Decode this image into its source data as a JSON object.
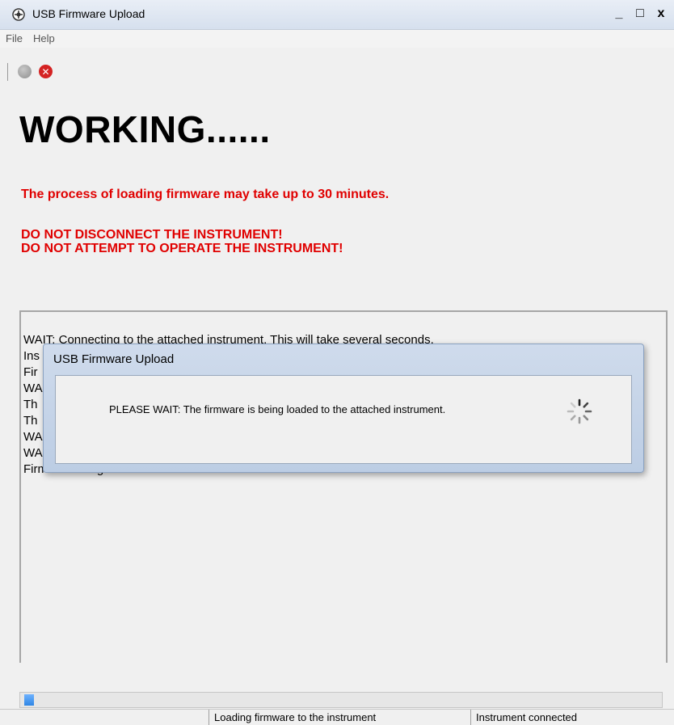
{
  "window": {
    "title": "USB Firmware Upload",
    "minimize": "_",
    "maximize": "□",
    "close": "x"
  },
  "menu": {
    "items": [
      "File",
      "Help"
    ]
  },
  "toolbar": {
    "stop_glyph": "✕"
  },
  "main": {
    "heading": "WORKING......",
    "warning_time": "The process of loading firmware may take up to 30 minutes.",
    "warning_disconnect": "DO NOT DISCONNECT THE INSTRUMENT!",
    "warning_operate": "DO NOT ATTEMPT TO OPERATE THE INSTRUMENT!"
  },
  "log": {
    "lines": [
      "WAIT: Connecting to the attached instrument. This will take several seconds.",
      "Ins",
      "Fir",
      "WA",
      "Th",
      "Th",
      "WA",
      "WA",
      "Firmware image erase successful"
    ]
  },
  "dialog": {
    "title": "USB Firmware Upload",
    "message": "PLEASE WAIT: The firmware is being loaded to the attached instrument."
  },
  "progress": {
    "value": 0.015
  },
  "status": {
    "cells": [
      "",
      "Loading firmware to the instrument",
      "Instrument connected"
    ]
  },
  "colors": {
    "warning": "#e00000",
    "progress_fill": "#2f86e4"
  }
}
